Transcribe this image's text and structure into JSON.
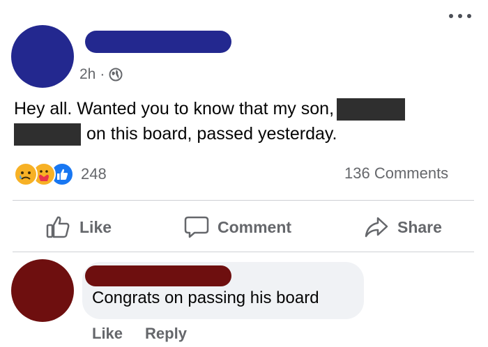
{
  "post": {
    "time": "2h",
    "separator": "·",
    "text_part1": "Hey all.  Wanted you to know that my son,",
    "text_part2": "on this board, passed yesterday.",
    "reaction_count": "248",
    "comments_count": "136 Comments",
    "reactions": [
      "sad-reaction-icon",
      "care-reaction-icon",
      "like-reaction-icon"
    ]
  },
  "actions": {
    "like": "Like",
    "comment": "Comment",
    "share": "Share"
  },
  "comment": {
    "text": "Congrats on passing his board",
    "like": "Like",
    "reply": "Reply"
  },
  "colors": {
    "poster_avatar": "#23288f",
    "commenter_avatar": "#6e0f0f",
    "redaction": "#2f2f2f",
    "secondary_text": "#65676b",
    "like_blue": "#1877f2",
    "bubble": "#f0f2f5"
  }
}
